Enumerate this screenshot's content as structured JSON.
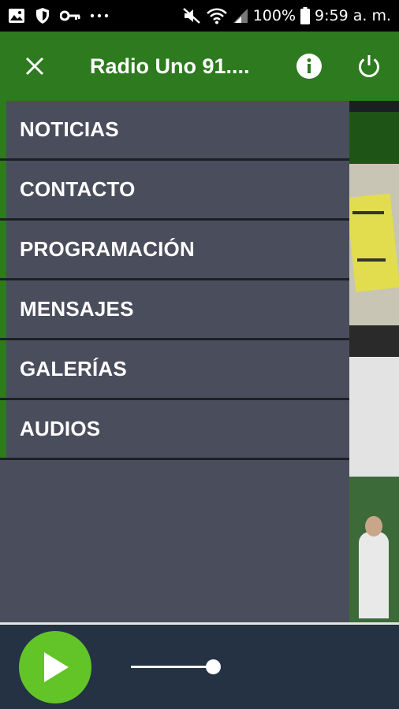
{
  "status_bar": {
    "battery_text": "100%",
    "time": "9:59 a. m.",
    "left_icons": [
      "image-icon",
      "shield-icon",
      "key-icon",
      "more-icon"
    ],
    "right_icons": [
      "mute-icon",
      "wifi-icon",
      "signal-icon",
      "battery-icon"
    ]
  },
  "app_bar": {
    "title": "Radio Uno 91....",
    "left_icon": "close-icon",
    "right_icons": [
      "info-icon",
      "power-icon"
    ]
  },
  "drawer": {
    "items": [
      {
        "label": "NOTICIAS"
      },
      {
        "label": "CONTACTO"
      },
      {
        "label": "PROGRAMACIÓN"
      },
      {
        "label": "MENSAJES"
      },
      {
        "label": "GALERÍAS"
      },
      {
        "label": "AUDIOS"
      }
    ]
  },
  "player": {
    "play_icon": "play-icon",
    "volume_level": 0.95
  },
  "colors": {
    "app_bar": "#2d7a1f",
    "drawer": "#4a4e5c",
    "player": "#243244",
    "play_button": "#63c428"
  }
}
